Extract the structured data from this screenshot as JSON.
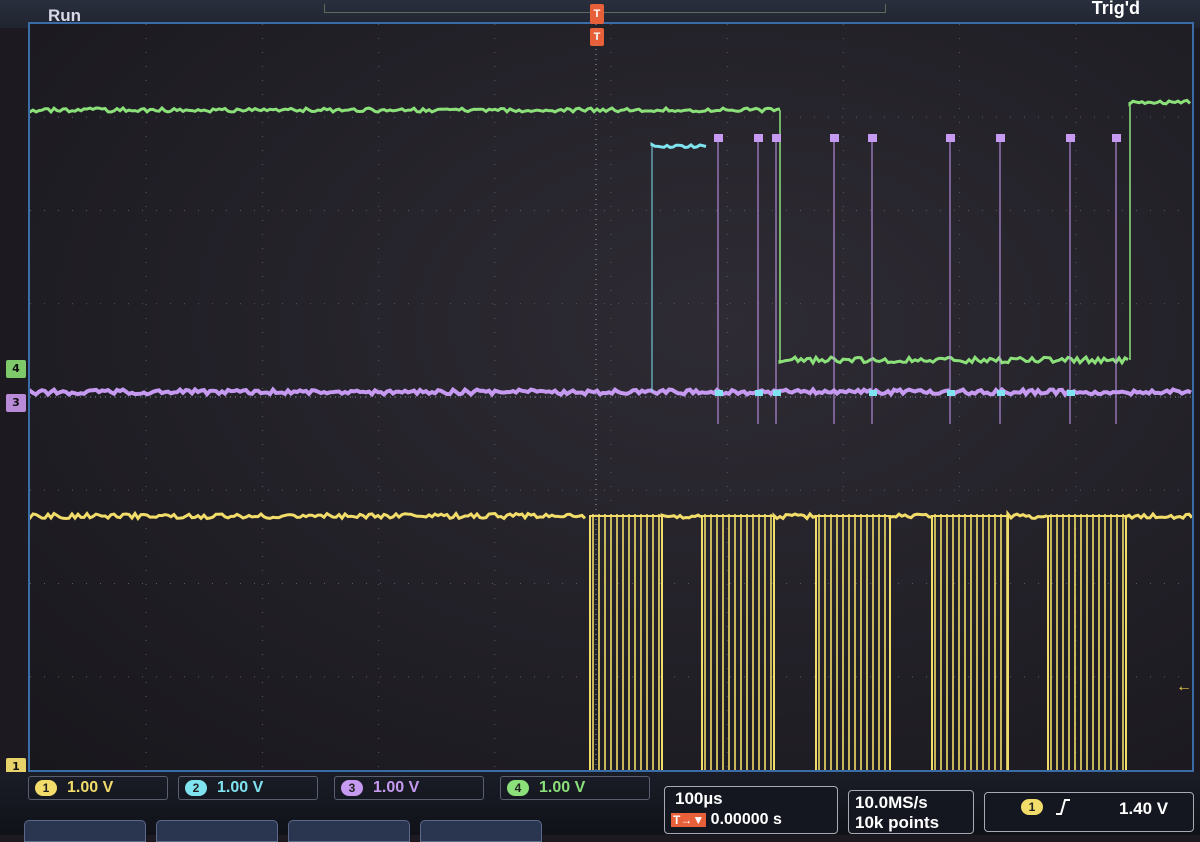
{
  "status": {
    "acquisition": "Run",
    "trigger_state": "Trig'd"
  },
  "trigger_marker": {
    "top_glyph": "T",
    "label": "T"
  },
  "channel_markers": [
    {
      "label": "4",
      "color": "#7ec96a"
    },
    {
      "label": "3",
      "color": "#b98ad8"
    },
    {
      "label": "1",
      "color": "#e8d36a"
    }
  ],
  "channels": [
    {
      "num": "1",
      "scale": "1.00 V",
      "color": "#f2dc6a"
    },
    {
      "num": "2",
      "scale": "1.00 V",
      "color": "#7fe3f0"
    },
    {
      "num": "3",
      "scale": "1.00 V",
      "color": "#c59af0"
    },
    {
      "num": "4",
      "scale": "1.00 V",
      "color": "#8be07a"
    }
  ],
  "timebase": {
    "scale": "100µs",
    "position": "0.00000 s",
    "position_icon": "T→▼"
  },
  "acquisition": {
    "sample_rate": "10.0MS/s",
    "record_length": "10k points"
  },
  "trigger": {
    "source": "1",
    "slope_icon": "rising-edge-icon",
    "level": "1.40 V"
  },
  "colors": {
    "ch1": "#f2dc6a",
    "ch2": "#7fe3f0",
    "ch3": "#c59af0",
    "ch4": "#8be07a",
    "frame": "#3a6da8",
    "trigger": "#e8603a"
  }
}
